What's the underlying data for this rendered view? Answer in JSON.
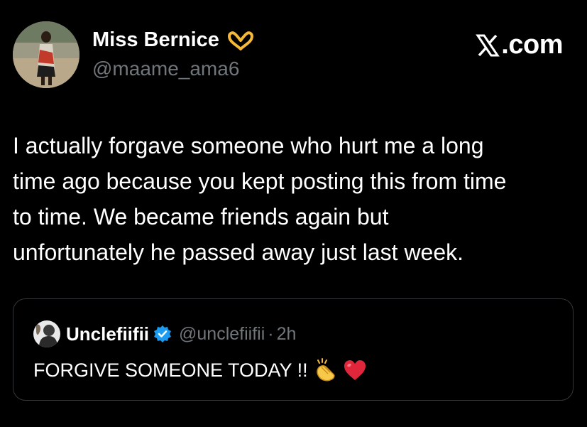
{
  "author": {
    "display_name": "Miss Bernice",
    "handle": "@maame_ama6",
    "name_emoji_icon": "heart-hands-icon"
  },
  "brand": {
    "logo_icon": "x-logo-icon",
    "label": ".com"
  },
  "tweet": {
    "text": "I actually forgave someone who hurt me a long\ntime ago because you kept posting this from time\nto time. We became friends again but\nunfortunately he passed away just last week."
  },
  "quoted_tweet": {
    "display_name": "Unclefiifii",
    "verified_icon": "verified-badge-icon",
    "handle": "@unclefiifii",
    "separator": "·",
    "time": "2h",
    "text": "FORGIVE SOMEONE TODAY !!",
    "emojis": [
      "clapping-hands-icon",
      "red-heart-icon"
    ]
  },
  "colors": {
    "background": "#000000",
    "primary_text": "#ffffff",
    "secondary_text": "#71767b",
    "border": "#333639",
    "verified_blue": "#1d9bf0",
    "heart_red": "#e0263a"
  }
}
